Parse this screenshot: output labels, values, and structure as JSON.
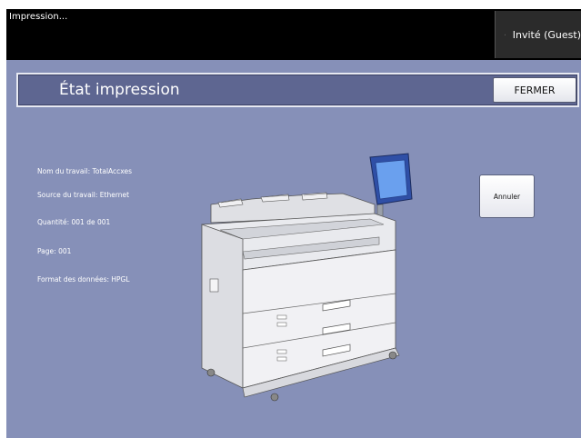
{
  "topbar": {
    "title": "Impression...",
    "user_label": "Invité (Guest)"
  },
  "header": {
    "title": "État impression",
    "close_label": "FERMER"
  },
  "job_info": {
    "job_name": "Nom du travail: TotalAccxes",
    "job_source": "Source du travail: Ethernet",
    "quantity": "Quantité: 001 de 001",
    "page": "Page: 001",
    "data_format": "Format des données: HPGL"
  },
  "actions": {
    "cancel_label": "Annuler"
  },
  "colors": {
    "background": "#8690b8",
    "header_bar": "#5e6691",
    "top_bar": "#000000"
  },
  "icons": {
    "user": "lock-user-icon",
    "device": "wide-format-printer-illustration"
  }
}
